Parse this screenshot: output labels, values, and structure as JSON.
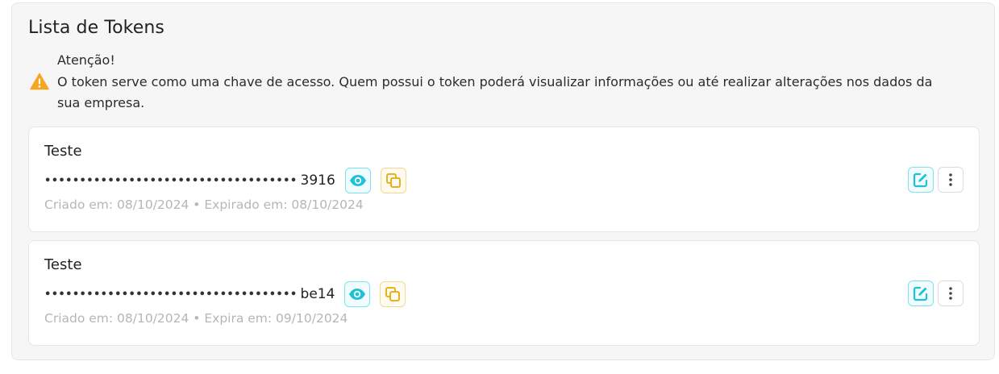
{
  "panel": {
    "title": "Lista de Tokens"
  },
  "warning": {
    "icon": "warning-triangle-icon",
    "heading": "Atenção!",
    "message": "O token serve como uma chave de acesso. Quem possui o token poderá visualizar informações ou até realizar alterações nos dados da sua empresa."
  },
  "tokens": [
    {
      "name": "Teste",
      "mask": "••••••••••••••••••••••••••••••••••••",
      "suffix": "3916",
      "meta": "Criado em: 08/10/2024 • Expirado em: 08/10/2024"
    },
    {
      "name": "Teste",
      "mask": "••••••••••••••••••••••••••••••••••••",
      "suffix": "be14",
      "meta": "Criado em: 08/10/2024 • Expira em: 09/10/2024"
    }
  ],
  "icons": {
    "view": "eye-icon",
    "copy": "copy-icon",
    "edit": "edit-icon",
    "more": "kebab-menu-icon"
  },
  "colors": {
    "accent_cyan": "#1cc3d6",
    "accent_yellow": "#e8b21a",
    "warning_orange": "#f5a623",
    "muted_text": "#b6b6b6"
  }
}
